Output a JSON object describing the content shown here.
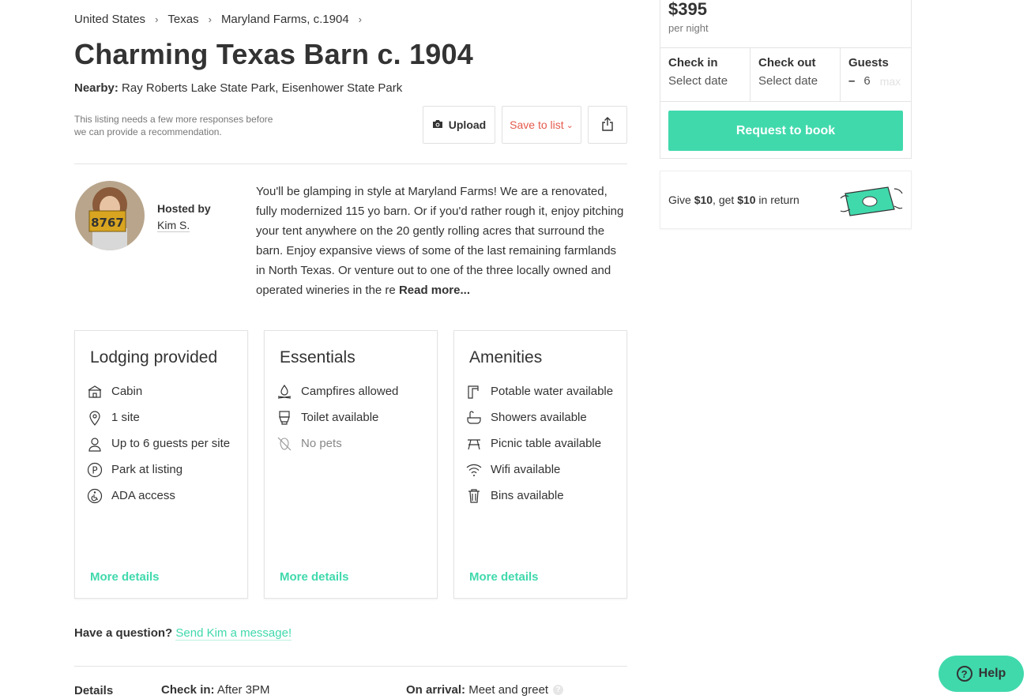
{
  "breadcrumb": [
    "United States",
    "Texas",
    "Maryland Farms, c.1904"
  ],
  "title": "Charming Texas Barn c. 1904",
  "nearby": {
    "label": "Nearby:",
    "value": "Ray Roberts Lake State Park, Eisenhower State Park"
  },
  "notice": "This listing needs a few more responses before we can provide a recommendation.",
  "actions": {
    "upload_label": "Upload",
    "save_label": "Save to list",
    "upload_icon": "camera-icon",
    "share_icon": "share-icon"
  },
  "host": {
    "hosted_by_label": "Hosted by",
    "name": "Kim S."
  },
  "description": {
    "text": "You'll be glamping in style at Maryland Farms!  We are a renovated, fully modernized 115 yo barn.  Or if you'd rather rough it, enjoy pitching your tent anywhere on the 20 gently rolling acres that surround the barn.  Enjoy expansive views of some of the last remaining farmlands in North Texas.  Or venture out to one of the three locally owned and operated wineries in the re",
    "read_more": "Read more..."
  },
  "cards": {
    "lodging": {
      "title": "Lodging provided",
      "items": [
        {
          "label": "Cabin",
          "icon": "cabin-icon"
        },
        {
          "label": "1 site",
          "icon": "location-pin-icon"
        },
        {
          "label": "Up to 6 guests per site",
          "icon": "guests-icon"
        },
        {
          "label": "Park at listing",
          "icon": "parking-icon"
        },
        {
          "label": "ADA access",
          "icon": "accessibility-icon"
        }
      ],
      "more": "More details"
    },
    "essentials": {
      "title": "Essentials",
      "items": [
        {
          "label": "Campfires allowed",
          "icon": "campfire-icon"
        },
        {
          "label": "Toilet available",
          "icon": "toilet-icon"
        },
        {
          "label": "No pets",
          "icon": "no-pets-icon"
        }
      ],
      "more": "More details"
    },
    "amenities": {
      "title": "Amenities",
      "items": [
        {
          "label": "Potable water available",
          "icon": "water-tap-icon"
        },
        {
          "label": "Showers available",
          "icon": "shower-icon"
        },
        {
          "label": "Picnic table available",
          "icon": "picnic-table-icon"
        },
        {
          "label": "Wifi available",
          "icon": "wifi-icon"
        },
        {
          "label": "Bins available",
          "icon": "trash-bin-icon"
        }
      ],
      "more": "More details"
    }
  },
  "question": {
    "label": "Have a question?",
    "link": "Send Kim a message!"
  },
  "details": {
    "label": "Details",
    "checkin_label": "Check in:",
    "checkin_value": "After 3PM",
    "arrival_label": "On arrival:",
    "arrival_value": "Meet and greet"
  },
  "booking": {
    "price": "$395",
    "per_night": "per night",
    "checkin_label": "Check in",
    "checkin_value": "Select date",
    "checkout_label": "Check out",
    "checkout_value": "Select date",
    "guests_label": "Guests",
    "guests_minus": "–",
    "guests_value": "6",
    "guests_max": "max",
    "request_label": "Request to book"
  },
  "referral": {
    "prefix": "Give ",
    "give_amount": "$10",
    "middle": ", get ",
    "get_amount": "$10",
    "suffix": " in return"
  },
  "help": {
    "label": "Help",
    "icon_glyph": "?"
  },
  "colors": {
    "accent": "#40d9ac",
    "save": "#e45a4c"
  }
}
